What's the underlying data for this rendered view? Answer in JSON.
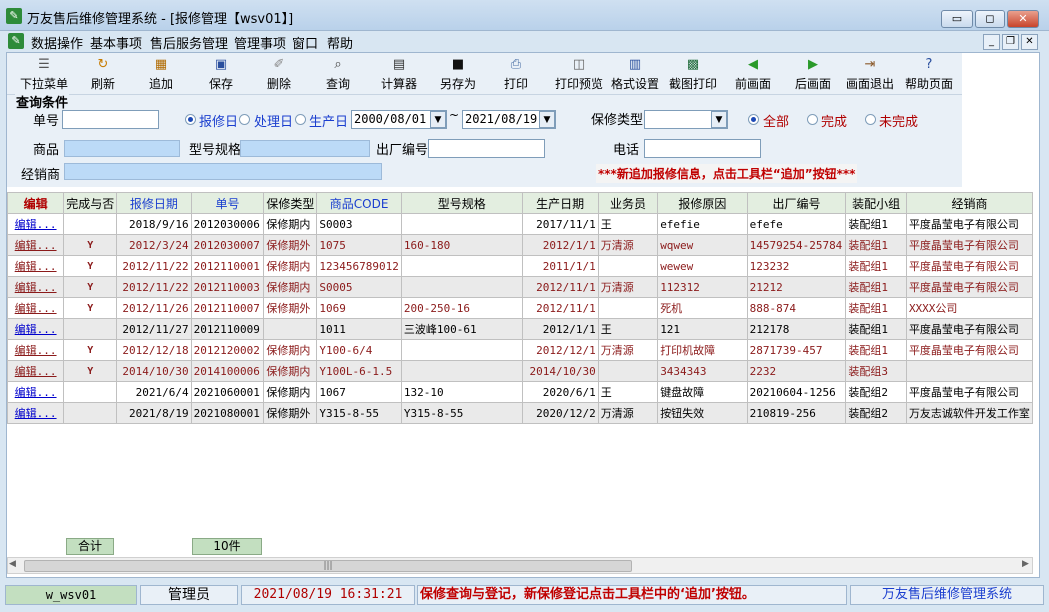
{
  "window": {
    "title": "万友售后维修管理系统 - [报修管理【wsv01】]",
    "app_icon": "wrench-icon"
  },
  "window_controls": {
    "minimize": "minimize-icon",
    "maximize": "maximize-icon",
    "close": "close-icon"
  },
  "menu": [
    "数据操作",
    "基本事项",
    "售后服务管理",
    "管理事项",
    "窗口",
    "帮助"
  ],
  "toolbar": [
    {
      "label": "下拉菜单",
      "icon": "dropdown-menu-icon"
    },
    {
      "label": "刷新",
      "icon": "refresh-icon"
    },
    {
      "label": "追加",
      "icon": "add-icon"
    },
    {
      "label": "保存",
      "icon": "save-icon"
    },
    {
      "label": "删除",
      "icon": "delete-icon"
    },
    {
      "label": "查询",
      "icon": "query-icon"
    },
    {
      "label": "计算器",
      "icon": "calculator-icon"
    },
    {
      "label": "另存为",
      "icon": "save-as-icon"
    },
    {
      "label": "打印",
      "icon": "print-icon"
    },
    {
      "label": "打印预览",
      "icon": "print-preview-icon"
    },
    {
      "label": "格式设置",
      "icon": "format-icon"
    },
    {
      "label": "截图打印",
      "icon": "screenshot-print-icon"
    },
    {
      "label": "前画面",
      "icon": "previous-icon"
    },
    {
      "label": "后画面",
      "icon": "next-icon"
    },
    {
      "label": "画面退出",
      "icon": "exit-icon"
    },
    {
      "label": "帮助页面",
      "icon": "help-icon"
    }
  ],
  "query": {
    "title": "查询条件",
    "order_no_label": "单号",
    "goods_label": "商品",
    "model_label": "型号规格",
    "factory_no_label": "出厂编号",
    "dealer_label": "经销商",
    "date_radios": [
      "报修日",
      "处理日",
      "生产日"
    ],
    "date_from": "2000/08/01",
    "date_sep": "~",
    "date_to": "2021/08/19",
    "warranty_label": "保修类型",
    "status_radios": [
      "全部",
      "完成",
      "未完成"
    ],
    "phone_label": "电话",
    "notice": "***新追加报修信息，点击工具栏“追加”按钮***"
  },
  "grid": {
    "columns": [
      "编辑",
      "完成与否",
      "报修日期",
      "单号",
      "保修类型",
      "商品CODE",
      "型号规格",
      "生产日期",
      "业务员",
      "报修原因",
      "出厂编号",
      "装配小组",
      "经销商"
    ],
    "rows": [
      [
        "编辑...",
        "",
        "2018/9/16",
        "2012030006",
        "保修期内",
        "S0003",
        "",
        "2017/11/1",
        "王",
        "efefie",
        "efefe",
        "装配组1",
        "平度晶莹电子有限公司"
      ],
      [
        "编辑...",
        "Y",
        "2012/3/24",
        "2012030007",
        "保修期外",
        "1075",
        "160-180",
        "2012/1/1",
        "万清源",
        "wqwew",
        "14579254-25784",
        "装配组1",
        "平度晶莹电子有限公司"
      ],
      [
        "编辑...",
        "Y",
        "2012/11/22",
        "2012110001",
        "保修期内",
        "123456789012",
        "",
        "2011/1/1",
        "",
        "wewew",
        "123232",
        "装配组1",
        "平度晶莹电子有限公司"
      ],
      [
        "编辑...",
        "Y",
        "2012/11/22",
        "2012110003",
        "保修期内",
        "S0005",
        "",
        "2012/11/1",
        "万清源",
        "112312",
        "21212",
        "装配组1",
        "平度晶莹电子有限公司"
      ],
      [
        "编辑...",
        "Y",
        "2012/11/26",
        "2012110007",
        "保修期外",
        "1069",
        "200-250-16",
        "2012/11/1",
        "",
        "死机",
        "888-874",
        "装配组1",
        "XXXX公司"
      ],
      [
        "编辑...",
        "",
        "2012/11/27",
        "2012110009",
        "",
        "1011",
        "三波峰100-61",
        "2012/1/1",
        "王",
        "121",
        "212178",
        "装配组1",
        "平度晶莹电子有限公司"
      ],
      [
        "编辑...",
        "Y",
        "2012/12/18",
        "2012120002",
        "保修期内",
        "Y100-6/4",
        "",
        "2012/12/1",
        "万清源",
        "打印机故障",
        "2871739-457",
        "装配组1",
        "平度晶莹电子有限公司"
      ],
      [
        "编辑...",
        "Y",
        "2014/10/30",
        "2014100006",
        "保修期内",
        "Y100L-6-1.5",
        "",
        "2014/10/30",
        "",
        "3434343",
        "2232",
        "装配组3",
        ""
      ],
      [
        "编辑...",
        "",
        "2021/6/4",
        "2021060001",
        "保修期内",
        "1067",
        "132-10",
        "2020/6/1",
        "王",
        "键盘故障",
        "20210604-1256",
        "装配组2",
        "平度晶莹电子有限公司"
      ],
      [
        "编辑...",
        "",
        "2021/8/19",
        "2021080001",
        "保修期外",
        "Y315-8-55",
        "Y315-8-55",
        "2020/12/2",
        "万清源",
        "按钮失效",
        "210819-256",
        "装配组2",
        "万友志诚软件开发工作室"
      ]
    ],
    "red_rows": [
      1,
      2,
      3,
      4,
      6,
      7
    ],
    "total_label": "合计",
    "total_count": "10件"
  },
  "status": {
    "screen_id": "w_wsv01",
    "user": "管理员",
    "datetime": "2021/08/19 16:31:21",
    "message": "保修查询与登记，新保修登记点击工具栏中的‘追加’按钮。",
    "app_name": "万友售后维修管理系统"
  },
  "colors": {
    "accent": "#1a3ecf",
    "alert": "#c00000",
    "row_red": "#8b1a1a",
    "header_bg": "#e3eee0"
  }
}
